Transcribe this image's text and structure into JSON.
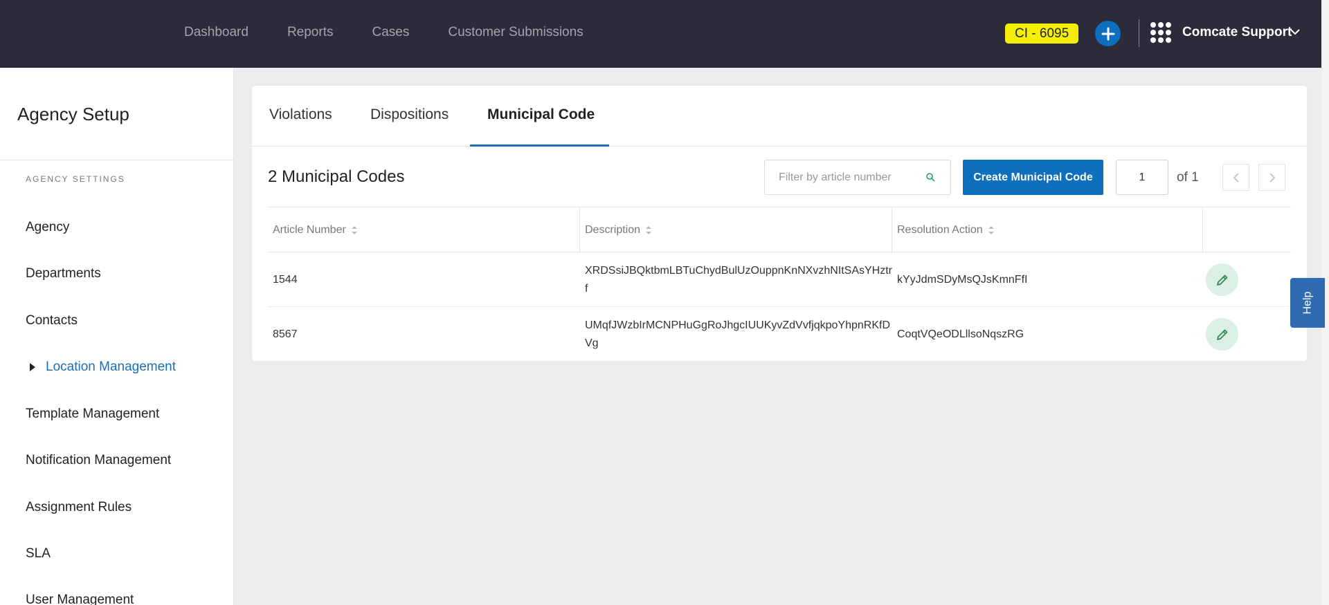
{
  "topbar": {
    "nav": [
      "Dashboard",
      "Reports",
      "Cases",
      "Customer Submissions"
    ],
    "ci_badge": "CI - 6095",
    "org_name": "Comcate Support"
  },
  "sidebar": {
    "title": "Agency Setup",
    "section_label": "AGENCY SETTINGS",
    "items": [
      {
        "label": "Agency"
      },
      {
        "label": "Departments"
      },
      {
        "label": "Contacts"
      },
      {
        "label": "Location Management"
      },
      {
        "label": "Template Management"
      },
      {
        "label": "Notification Management"
      },
      {
        "label": "Assignment Rules"
      },
      {
        "label": "SLA"
      },
      {
        "label": "User Management"
      }
    ]
  },
  "tabs": [
    "Violations",
    "Dispositions",
    "Municipal Code"
  ],
  "main": {
    "count_title": "2 Municipal Codes",
    "filter_placeholder": "Filter by article number",
    "create_button": "Create Municipal Code",
    "page_value": "1",
    "page_of": "of 1"
  },
  "table": {
    "headers": [
      "Article Number",
      "Description",
      "Resolution Action"
    ],
    "rows": [
      {
        "article": "1544",
        "description": "XRDSsiJBQktbmLBTuChydBulUzOuppnKnNXvzhNItSAsYHztrf",
        "resolution": "kYyJdmSDyMsQJsKmnFfI"
      },
      {
        "article": "8567",
        "description": "UMqfJWzbIrMCNPHuGgRoJhgcIUUKyvZdVvfjqkpoYhpnRKfDVg",
        "resolution": "CoqtVQeODLllsoNqszRG"
      }
    ]
  },
  "help": "Help",
  "colors": {
    "topbar_bg": "#2b2b39",
    "accent_blue": "#0d6fbd",
    "badge_yellow": "#f4f000",
    "edit_green": "#2e8b57"
  }
}
